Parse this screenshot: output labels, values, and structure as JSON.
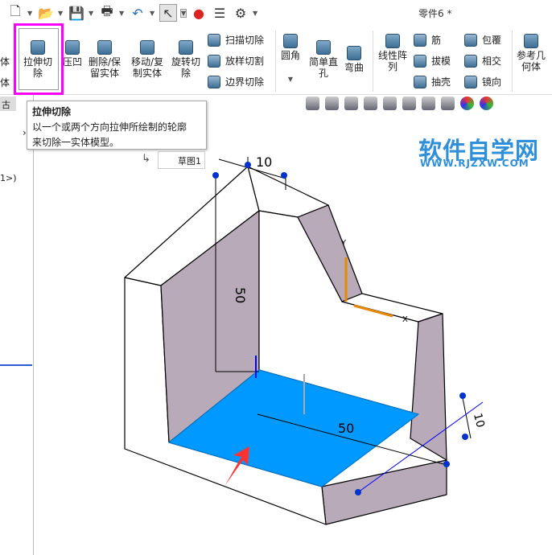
{
  "window": {
    "title": "零件6 *"
  },
  "quick_access": [
    {
      "icon": "new-file-icon"
    },
    {
      "icon": "open-folder-icon"
    },
    {
      "icon": "save-icon"
    },
    {
      "icon": "print-icon"
    },
    {
      "icon": "undo-icon"
    },
    {
      "icon": "select-cursor-icon"
    },
    {
      "icon": "rebuild-traffic-light-icon"
    },
    {
      "icon": "file-properties-icon"
    },
    {
      "icon": "options-gear-icon"
    }
  ],
  "ribbon": {
    "left_cut_labels": [
      "体",
      "体"
    ],
    "extrude_cut": "拉伸切\n除",
    "indent": "压凹",
    "delete_body": "删除/保\n留实体",
    "move_copy": "移动/复\n制实体",
    "revolve_cut": "旋转切\n除",
    "sweep_cut": "扫描切除",
    "loft_cut": "放样切割",
    "boundary_cut": "边界切除",
    "fillet": "圆角",
    "hole": "简单直\n孔",
    "flex": "弯曲",
    "linear_pattern": "线性阵\n列",
    "rib": "筋",
    "draft": "拔模",
    "shell": "抽壳",
    "wrap": "包覆",
    "intersect": "相交",
    "mirror": "镜向",
    "ref_geometry": "参考几\n何体"
  },
  "left_panel": {
    "tab": "古",
    "line": "1>)"
  },
  "tooltip": {
    "title": "拉伸切除",
    "line1": "以一个或两个方向拉伸所绘制的轮廓",
    "line2": "来切除一实体模型。"
  },
  "sketch_tag": "草图1",
  "watermark": {
    "title": "软件自学网",
    "url": "WWW.RJZXW.COM"
  },
  "dimensions": {
    "top": "10",
    "height": "50",
    "width": "50",
    "side": "10"
  },
  "axes": {
    "y": "Y",
    "x": "X"
  },
  "colors": {
    "highlight": "#ff00ff",
    "floor": "#0099ff",
    "face": "#b9aab9",
    "watermark": "#2f8fd8"
  }
}
